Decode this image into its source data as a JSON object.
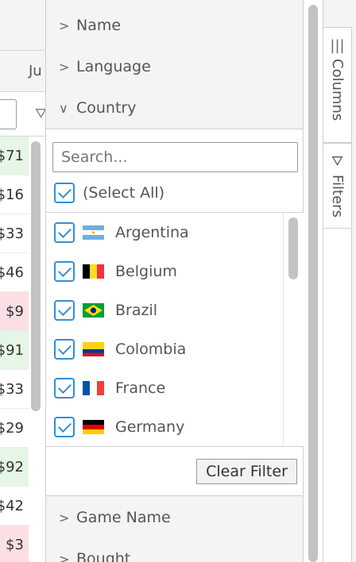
{
  "grid": {
    "column_header_partial": "Ju",
    "cells": [
      {
        "text": "$71",
        "tone": "green"
      },
      {
        "text": "$16",
        "tone": "white"
      },
      {
        "text": "$33",
        "tone": "white"
      },
      {
        "text": "$46",
        "tone": "white"
      },
      {
        "text": "$9",
        "tone": "pink"
      },
      {
        "text": "$91",
        "tone": "green"
      },
      {
        "text": "$33",
        "tone": "white"
      },
      {
        "text": "$29",
        "tone": "white"
      },
      {
        "text": "$92",
        "tone": "green"
      },
      {
        "text": "$42",
        "tone": "white"
      },
      {
        "text": "$3",
        "tone": "pink"
      }
    ]
  },
  "tool_panel": {
    "sections": [
      {
        "label": "Name",
        "expanded": false
      },
      {
        "label": "Language",
        "expanded": false
      },
      {
        "label": "Country",
        "expanded": true
      },
      {
        "label": "Game Name",
        "expanded": false
      },
      {
        "label": "Bought",
        "expanded": false
      }
    ],
    "filter": {
      "search_placeholder": "Search...",
      "select_all_label": "(Select All)",
      "select_all_checked": true,
      "items": [
        {
          "label": "Argentina",
          "checked": true,
          "flag": "argentina-flag-icon"
        },
        {
          "label": "Belgium",
          "checked": true,
          "flag": "belgium-flag-icon"
        },
        {
          "label": "Brazil",
          "checked": true,
          "flag": "brazil-flag-icon"
        },
        {
          "label": "Colombia",
          "checked": true,
          "flag": "colombia-flag-icon"
        },
        {
          "label": "France",
          "checked": true,
          "flag": "france-flag-icon"
        },
        {
          "label": "Germany",
          "checked": true,
          "flag": "germany-flag-icon"
        }
      ],
      "clear_button_label": "Clear Filter"
    }
  },
  "side_bar": {
    "tabs": [
      {
        "label": "Columns",
        "icon": "columns-icon"
      },
      {
        "label": "Filters",
        "icon": "filter-icon"
      }
    ]
  },
  "colors": {
    "accent": "#2f8fdc",
    "panel_bg": "#f3f4f3",
    "row_green": "#e6f6e6",
    "row_pink": "#fbdfe4"
  }
}
